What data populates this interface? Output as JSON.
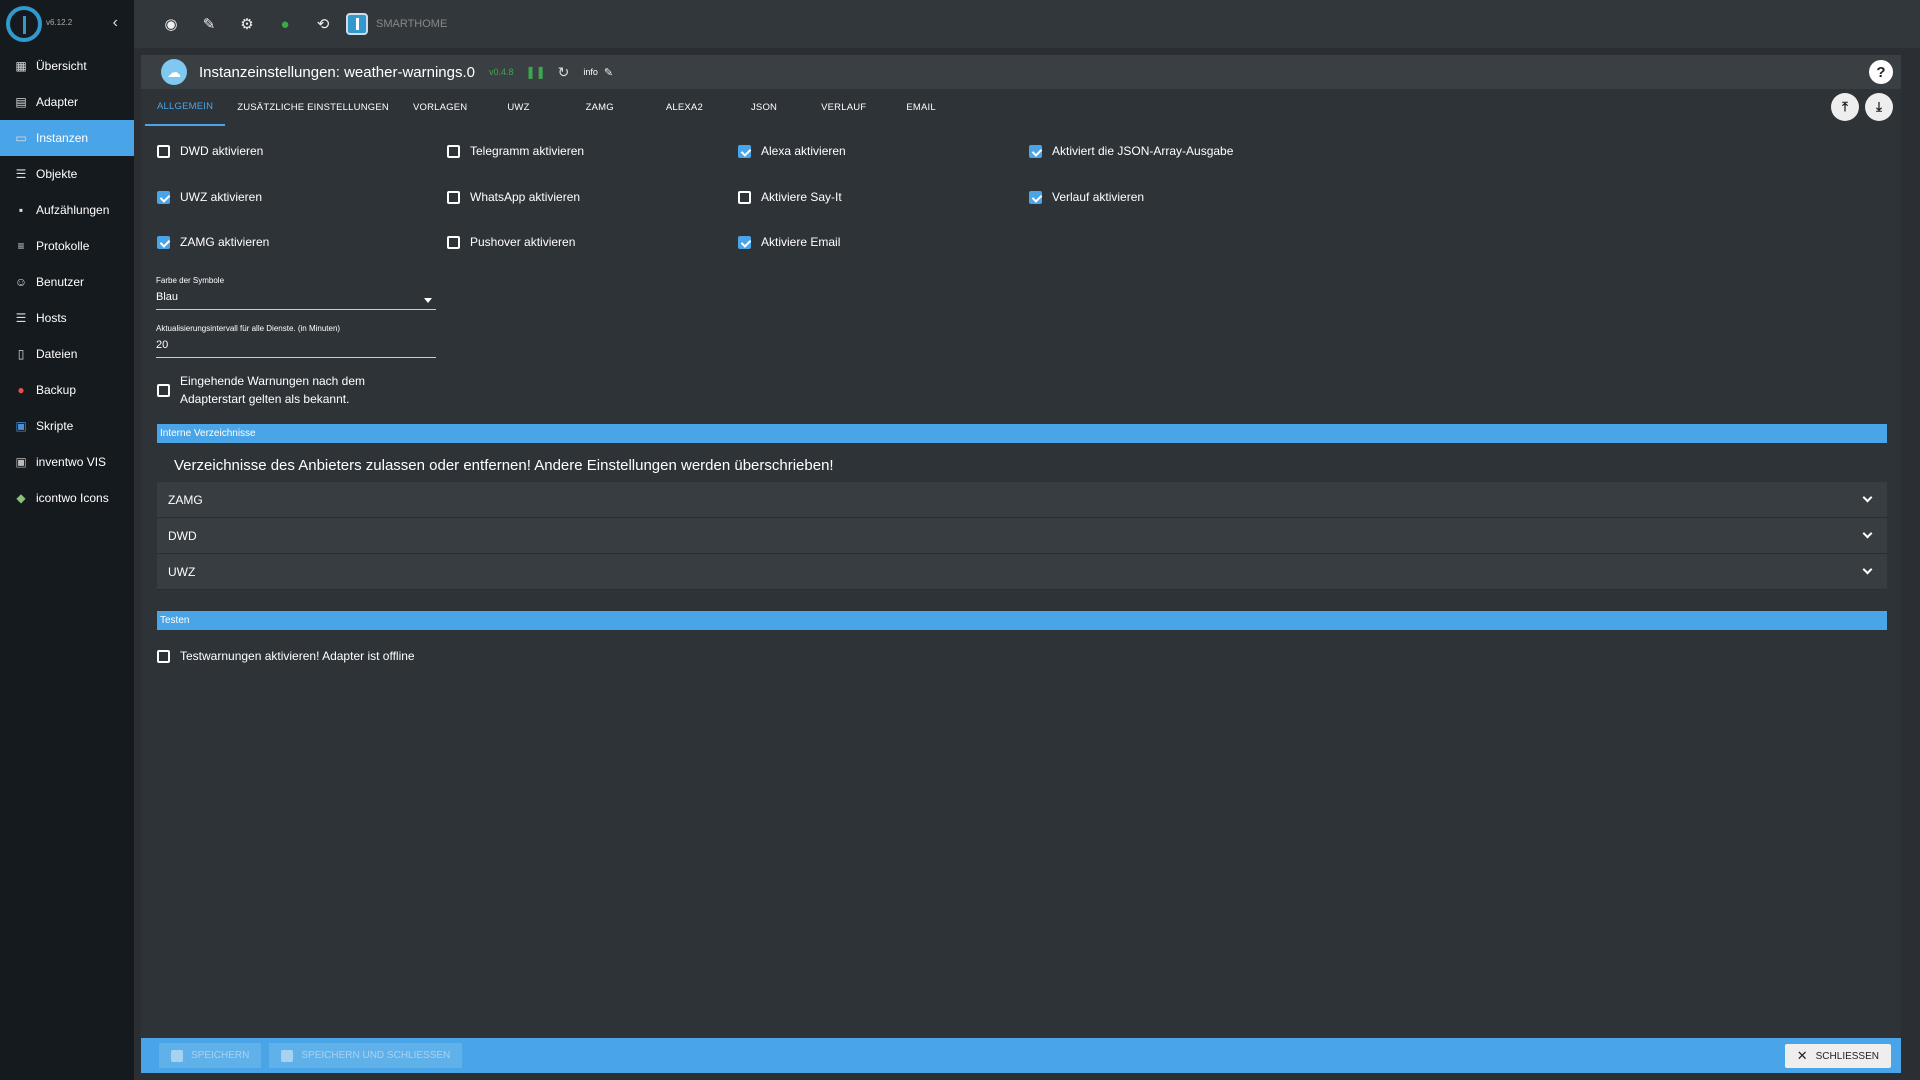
{
  "app": {
    "version": "v6.12.2",
    "brand": "SMARTHOME"
  },
  "sidebar": {
    "items": [
      {
        "label": "Übersicht",
        "icon": "grid-icon"
      },
      {
        "label": "Adapter",
        "icon": "store-icon"
      },
      {
        "label": "Instanzen",
        "icon": "instances-icon",
        "active": true
      },
      {
        "label": "Objekte",
        "icon": "list-icon"
      },
      {
        "label": "Aufzählungen",
        "icon": "enum-icon"
      },
      {
        "label": "Protokolle",
        "icon": "log-icon"
      },
      {
        "label": "Benutzer",
        "icon": "user-icon"
      },
      {
        "label": "Hosts",
        "icon": "hosts-icon"
      },
      {
        "label": "Dateien",
        "icon": "files-icon"
      },
      {
        "label": "Backup",
        "icon": "backup-icon"
      },
      {
        "label": "Skripte",
        "icon": "scripts-icon"
      },
      {
        "label": "inventwo VIS",
        "icon": "vis-icon"
      },
      {
        "label": "icontwo Icons",
        "icon": "icons-icon"
      }
    ]
  },
  "panel": {
    "title": "Instanzeinstellungen: weather-warnings.0",
    "version": "v0.4.8",
    "info": "info"
  },
  "tabs": [
    "ALLGEMEIN",
    "ZUSÄTZLICHE EINSTELLUNGEN",
    "VORLAGEN",
    "UWZ",
    "ZAMG",
    "ALEXA2",
    "JSON",
    "VERLAUF",
    "EMAIL"
  ],
  "checkboxes": {
    "dwd": {
      "label": "DWD aktivieren",
      "checked": false
    },
    "uwz": {
      "label": "UWZ aktivieren",
      "checked": true
    },
    "zamg": {
      "label": "ZAMG aktivieren",
      "checked": true
    },
    "telegram": {
      "label": "Telegramm aktivieren",
      "checked": false
    },
    "whatsapp": {
      "label": "WhatsApp aktivieren",
      "checked": false
    },
    "pushover": {
      "label": "Pushover aktivieren",
      "checked": false
    },
    "alexa": {
      "label": "Alexa aktivieren",
      "checked": true
    },
    "sayit": {
      "label": "Aktiviere Say-It",
      "checked": false
    },
    "email": {
      "label": "Aktiviere Email",
      "checked": true
    },
    "json": {
      "label": "Aktiviert die JSON-Array-Ausgabe",
      "checked": true
    },
    "history": {
      "label": "Verlauf aktivieren",
      "checked": true
    },
    "known_line1": "Eingehende Warnungen nach dem",
    "known_line2": "Adapterstart gelten als bekannt.",
    "test": {
      "label": "Testwarnungen aktivieren! Adapter ist offline",
      "checked": false
    }
  },
  "fields": {
    "color_label": "Farbe der Symbole",
    "color_value": "Blau",
    "interval_label": "Aktualisierungsintervall für alle Dienste. (in Minuten)",
    "interval_value": "20"
  },
  "sections": {
    "internal": "Interne Verzeichnisse",
    "notice": "Verzeichnisse des Anbieters zulassen oder entfernen! Andere Einstellungen werden überschrieben!",
    "accordions": [
      "ZAMG",
      "DWD",
      "UWZ"
    ],
    "test": "Testen"
  },
  "footer": {
    "save": "SPEICHERN",
    "save_close": "SPEICHERN UND SCHLIESSEN",
    "close": "SCHLIESSEN"
  },
  "colors": {
    "accent": "#4aa5e8",
    "sidebar": "#151a1f",
    "panel": "#2e3338"
  }
}
